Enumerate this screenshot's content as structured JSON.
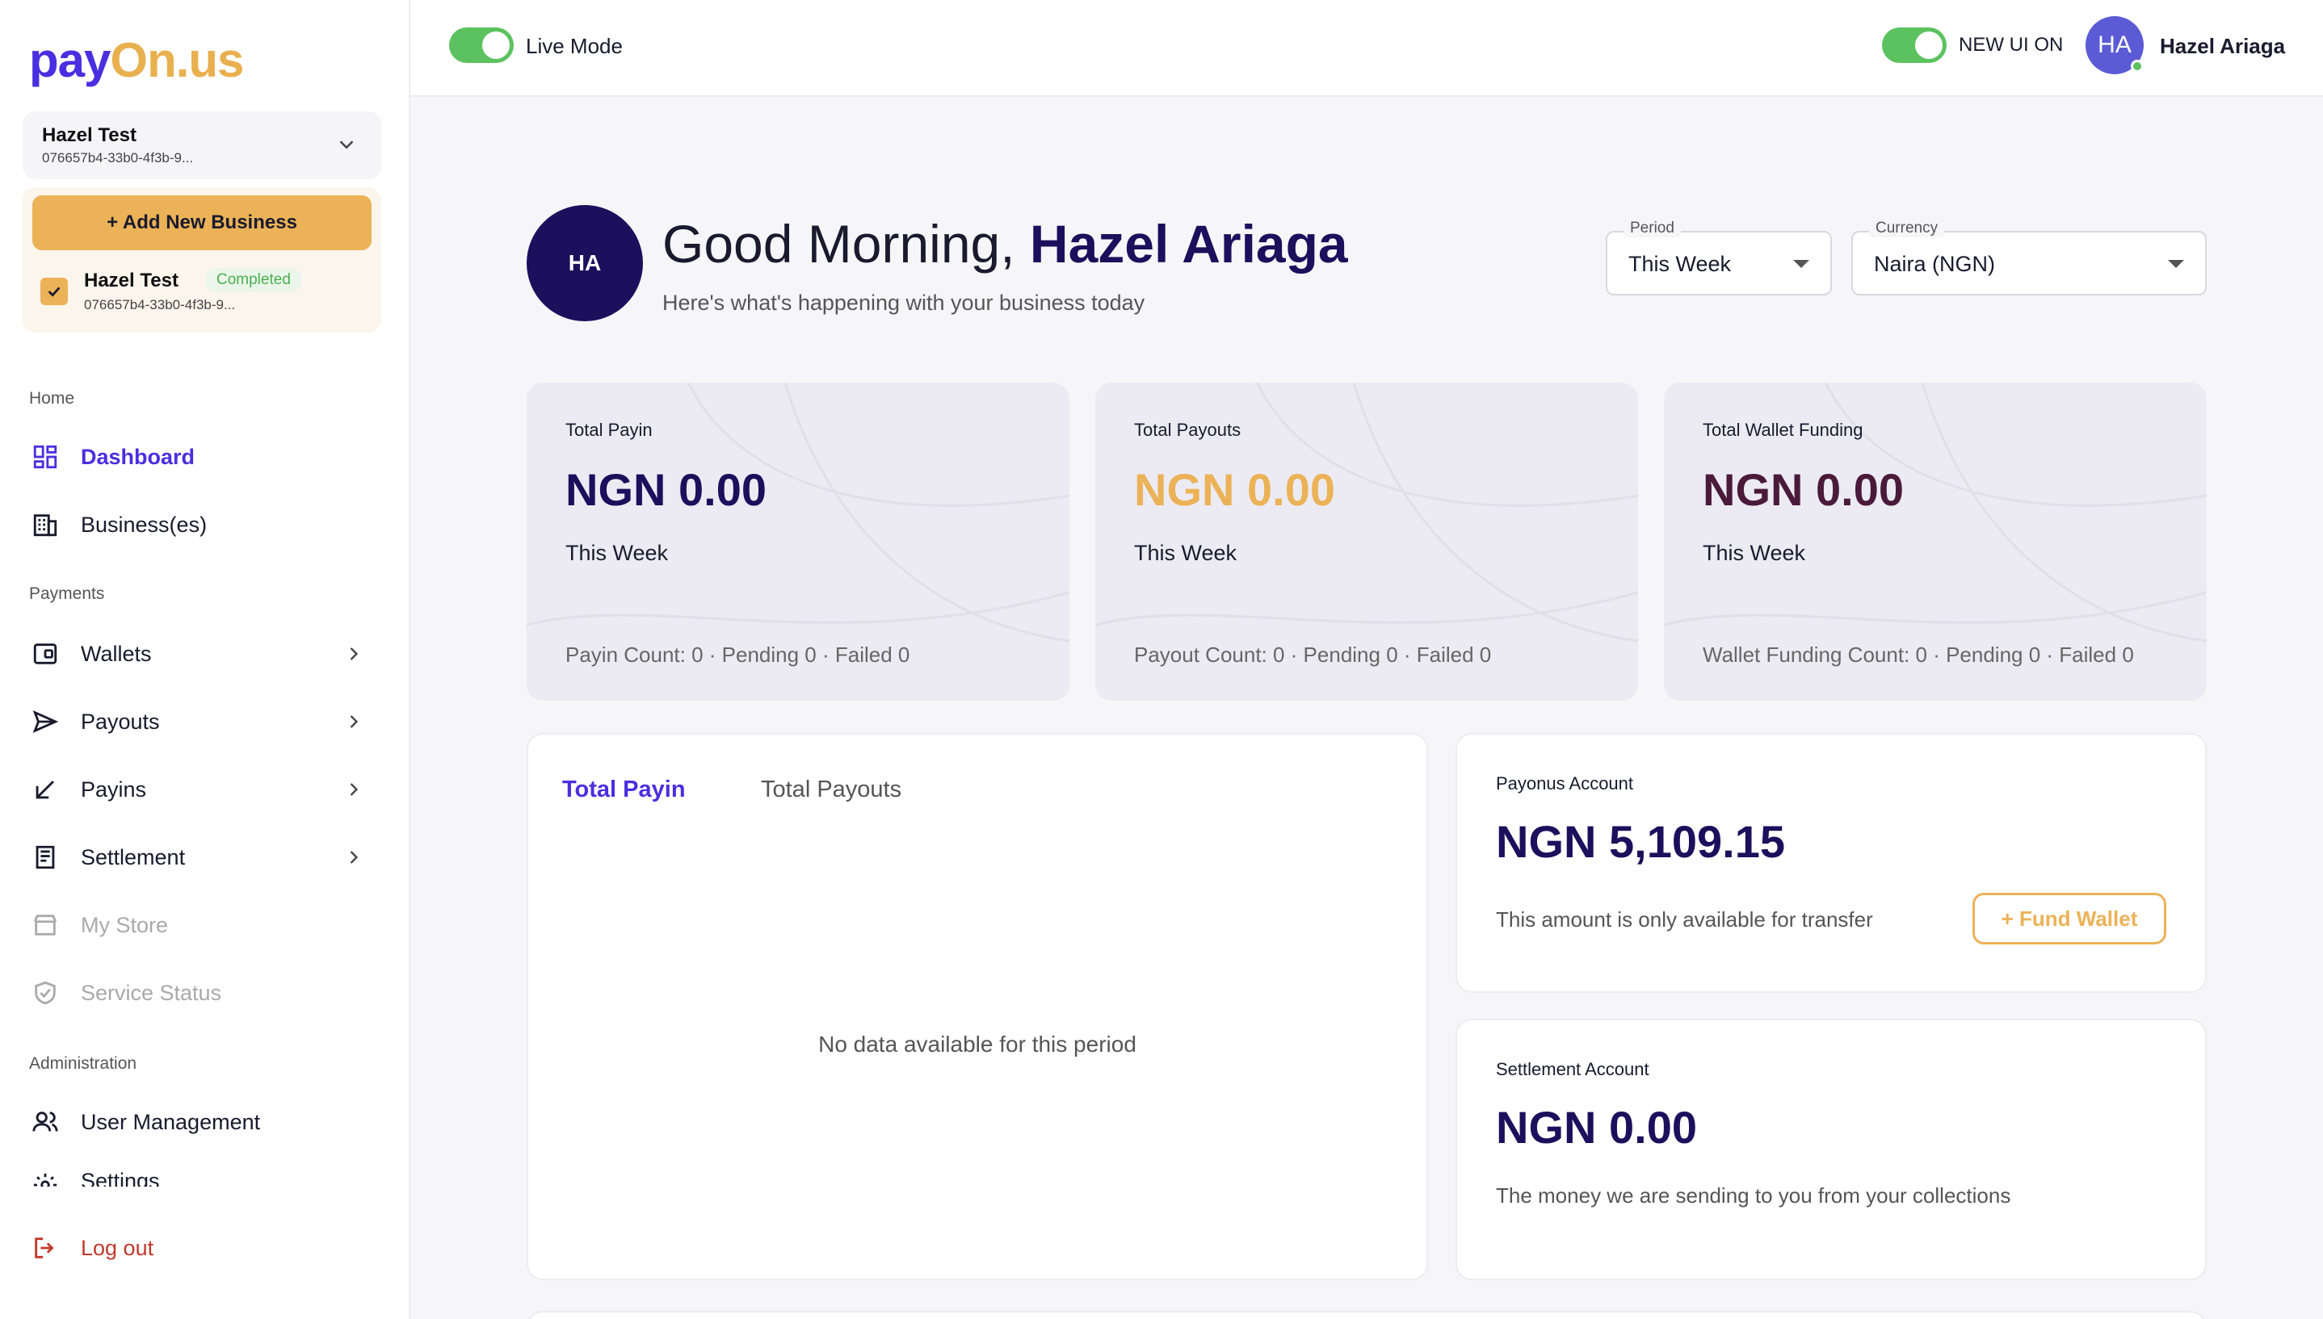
{
  "brand": {
    "pay": "pay",
    "o": "O",
    "nus": "n.us",
    "accent": "#4a2fe0",
    "gold": "#e9b04f"
  },
  "sidebar": {
    "business_selector": {
      "name": "Hazel Test",
      "id": "076657b4-33b0-4f3b-9..."
    },
    "add_button": "+ Add New Business",
    "business_item": {
      "name": "Hazel Test",
      "status": "Completed",
      "id": "076657b4-33b0-4f3b-9..."
    },
    "sections": {
      "home": "Home",
      "payments": "Payments",
      "administration": "Administration"
    },
    "items": {
      "dashboard": "Dashboard",
      "businesses": "Business(es)",
      "wallets": "Wallets",
      "payouts": "Payouts",
      "payins": "Payins",
      "settlement": "Settlement",
      "my_store": "My Store",
      "service_status": "Service Status",
      "user_management": "User Management",
      "settings": "Settings",
      "logout": "Log out"
    }
  },
  "topbar": {
    "live_mode": "Live Mode",
    "new_ui": "NEW UI ON",
    "avatar_initials": "HA",
    "user_name": "Hazel Ariaga"
  },
  "greeting": {
    "avatar_initials": "HA",
    "prefix": "Good Morning,",
    "name": "Hazel Ariaga",
    "subtitle": "Here's what's happening with your business today"
  },
  "filters": {
    "period": {
      "legend": "Period",
      "value": "This Week"
    },
    "currency": {
      "legend": "Currency",
      "value": "Naira (NGN)"
    }
  },
  "stats": [
    {
      "title": "Total Payin",
      "amount": "NGN 0.00",
      "period": "This Week",
      "counts": "Payin Count: 0 · Pending 0 · Failed 0",
      "color": "#1c0f5c"
    },
    {
      "title": "Total Payouts",
      "amount": "NGN 0.00",
      "period": "This Week",
      "counts": "Payout Count: 0 · Pending 0 · Failed 0",
      "color": "#ebb257"
    },
    {
      "title": "Total Wallet Funding",
      "amount": "NGN 0.00",
      "period": "This Week",
      "counts": "Wallet Funding Count: 0 · Pending 0 · Failed 0",
      "color": "#4a1a3a"
    }
  ],
  "chart_card": {
    "tabs": [
      "Total Payin",
      "Total Payouts"
    ],
    "empty": "No data available for this period"
  },
  "payonus_account": {
    "title": "Payonus Account",
    "amount": "NGN 5,109.15",
    "note": "This amount is only available for transfer",
    "fund_button": "+ Fund Wallet"
  },
  "settlement_account": {
    "title": "Settlement Account",
    "amount": "NGN 0.00",
    "note": "The money we are sending to you from your collections"
  }
}
